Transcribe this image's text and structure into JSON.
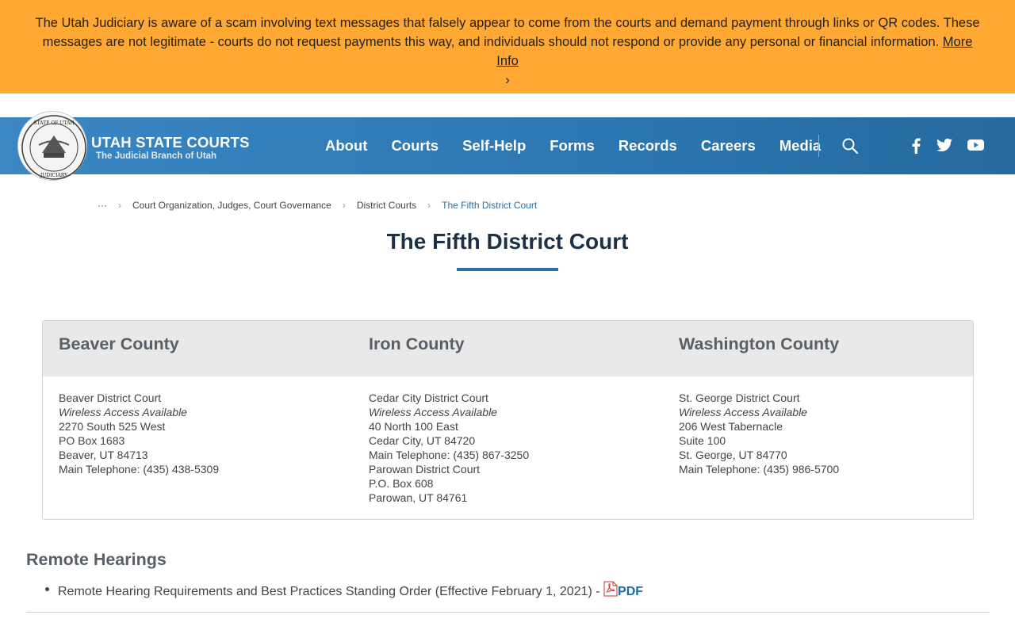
{
  "alert": {
    "text": "The Utah Judiciary is aware of a scam involving text messages that falsely appear to come from the courts and demand payment through links or QR codes. These messages are not legitimate - courts do not request payments this way, and individuals should not respond or provide any personal or financial information.",
    "link_label": "More Info",
    "chevron": "›",
    "color": "#ffa834"
  },
  "header": {
    "brand_title": "UTAH STATE COURTS",
    "brand_subtitle": "The Judicial Branch of Utah",
    "seal_top": "STATE OF UTAH",
    "seal_bottom": "JUDICIARY",
    "nav": [
      "About",
      "Courts",
      "Self-Help",
      "Forms",
      "Records",
      "Careers",
      "Media"
    ],
    "icons": [
      "search-icon",
      "facebook-icon",
      "twitter-icon",
      "youtube-icon"
    ],
    "color": "#2d78b3"
  },
  "breadcrumb": {
    "ellipsis": "···",
    "items": [
      "Court Organization, Judges, Court Governance",
      "District Courts"
    ],
    "current": "The Fifth District Court",
    "separator": "›"
  },
  "page": {
    "title": "The Fifth District Court"
  },
  "counties": [
    {
      "name": "Beaver County",
      "court": "Beaver District Court",
      "wireless": "Wireless Access Available",
      "lines": [
        "2270 South 525 West",
        "PO Box 1683",
        "Beaver, UT 84713",
        "Main Telephone: (435) 438-5309"
      ]
    },
    {
      "name": "Iron County",
      "court": "Cedar City District Court",
      "wireless": "Wireless Access Available",
      "lines": [
        "40 North 100 East",
        "Cedar City, UT 84720",
        "Main Telephone: (435) 867-3250",
        "Parowan District Court",
        "P.O. Box 608",
        "Parowan, UT 84761"
      ]
    },
    {
      "name": "Washington County",
      "court": "St. George District Court",
      "wireless": "Wireless Access Available",
      "lines": [
        "206 West Tabernacle",
        "Suite 100",
        "St. George, UT 84770",
        "Main Telephone: (435) 986-5700"
      ]
    }
  ],
  "remote_hearings": {
    "title": "Remote Hearings",
    "item_text": "Remote Hearing Requirements and Best Practices Standing Order (Effective February 1, 2021) - ",
    "pdf_label": "PDF"
  }
}
